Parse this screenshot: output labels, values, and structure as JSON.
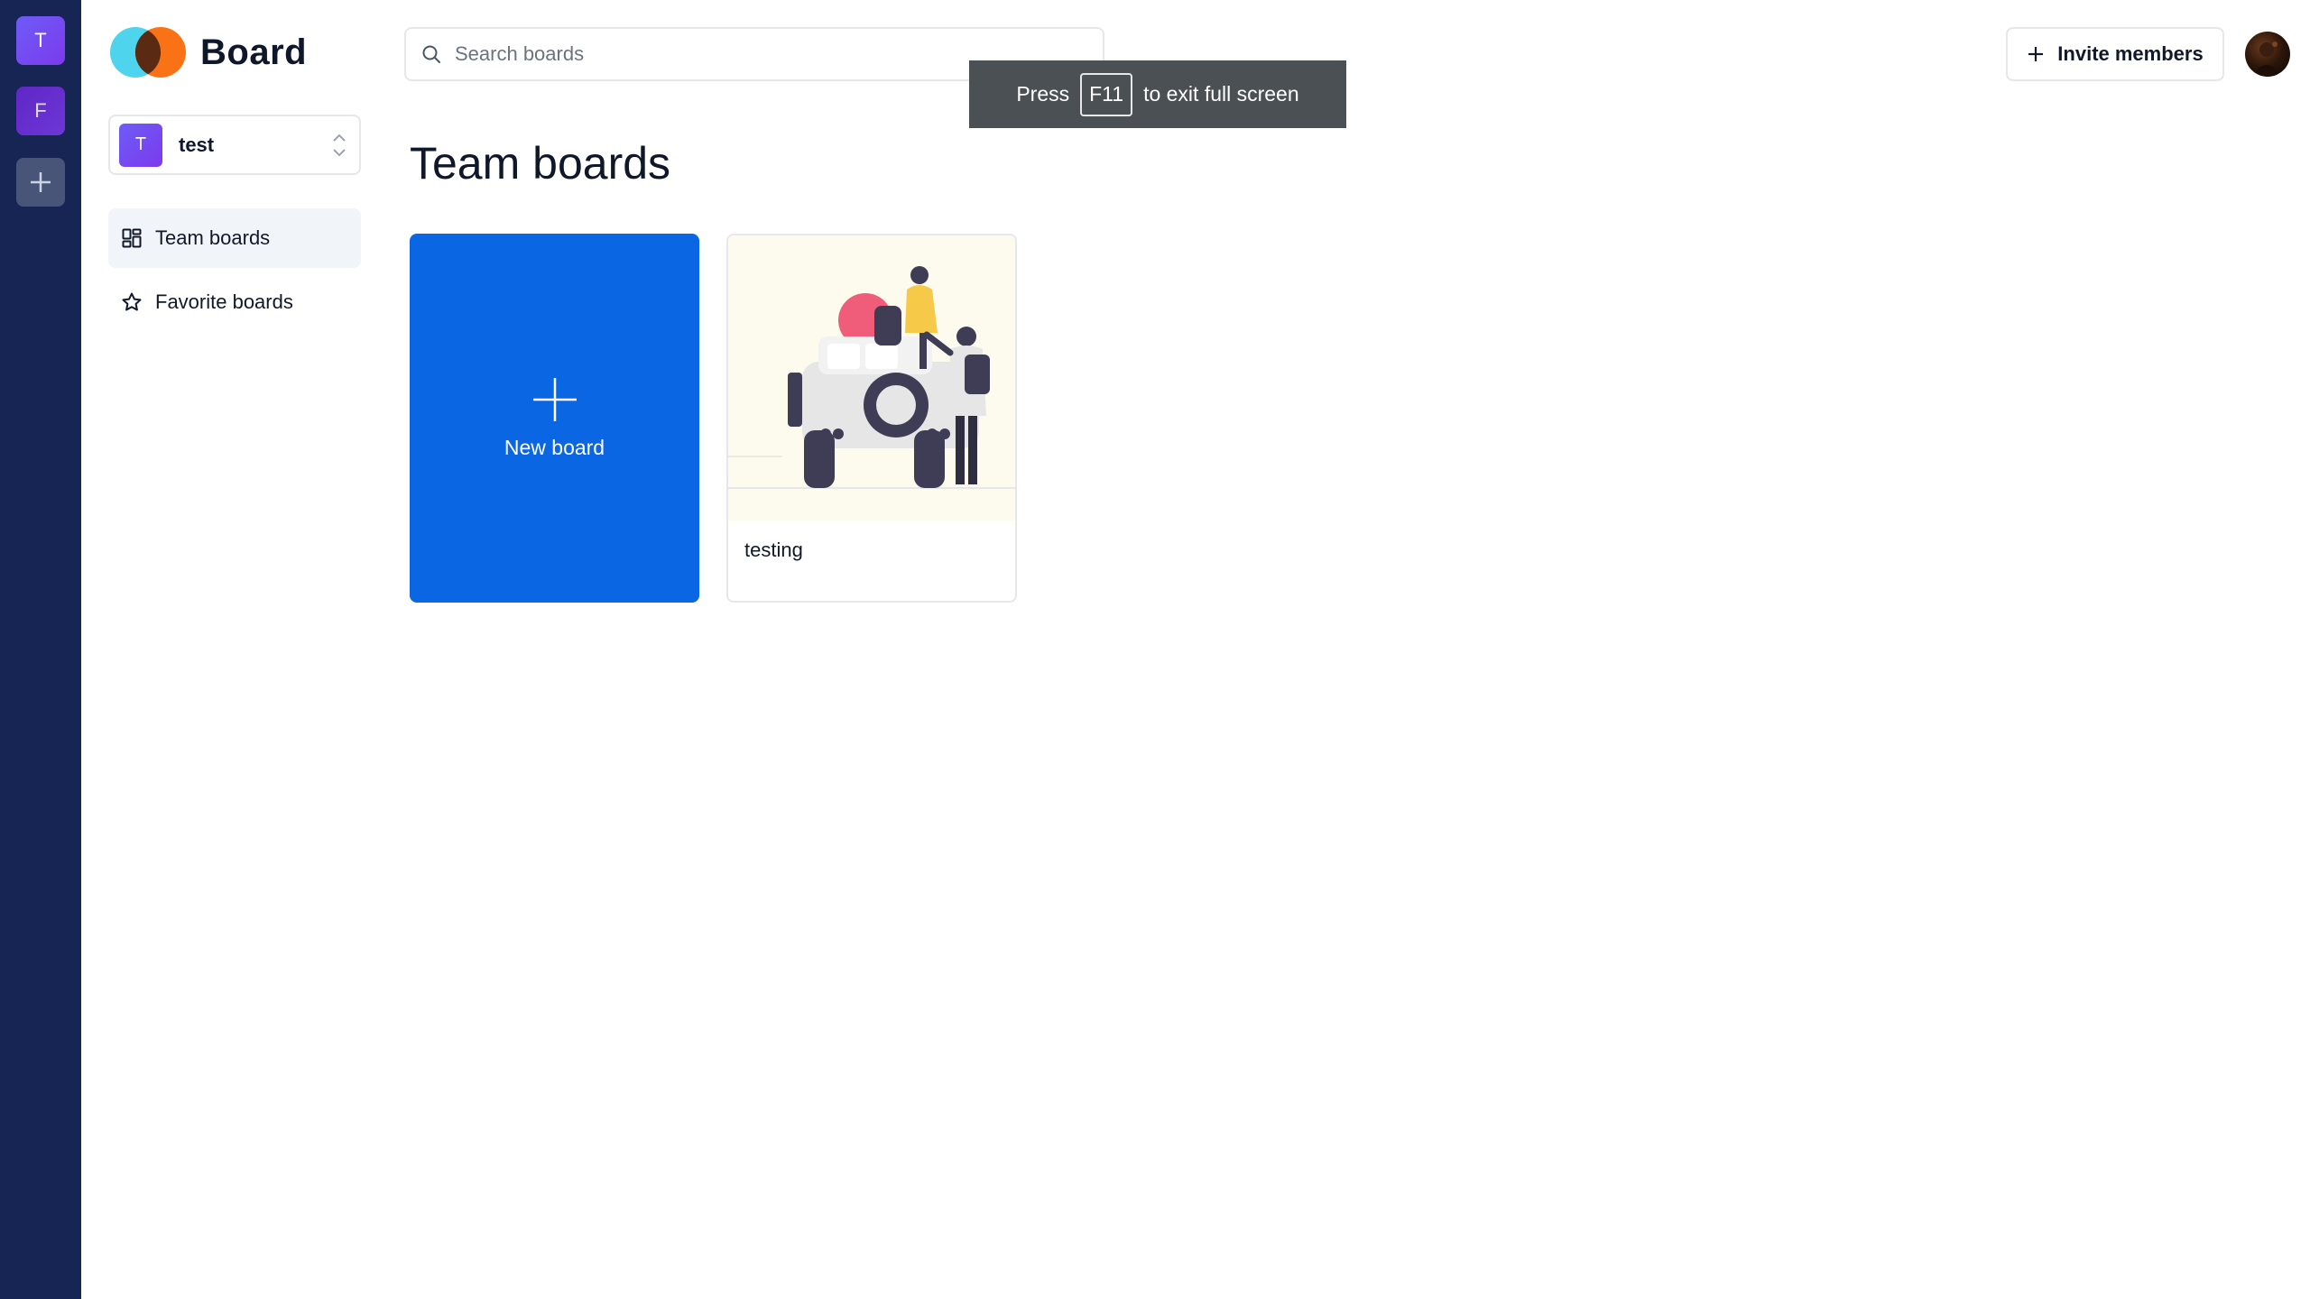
{
  "rail": {
    "orgs": [
      {
        "initial": "T"
      },
      {
        "initial": "F"
      }
    ],
    "add_icon": "plus-icon"
  },
  "sidebar": {
    "logo_title": "Board",
    "org": {
      "initial": "T",
      "name": "test"
    },
    "nav": [
      {
        "label": "Team boards",
        "icon": "dashboard-icon",
        "active": true
      },
      {
        "label": "Favorite boards",
        "icon": "star-icon",
        "active": false
      }
    ]
  },
  "header": {
    "search_placeholder": "Search boards",
    "invite_label": "Invite members"
  },
  "fullscreen_toast": {
    "prefix": "Press",
    "key": "F11",
    "suffix": "to exit full screen"
  },
  "main": {
    "title": "Team boards",
    "new_board_label": "New board",
    "boards": [
      {
        "title": "testing"
      }
    ]
  },
  "colors": {
    "rail_bg": "#172554",
    "primary": "#0b66e4",
    "org_gradient_start": "#6d5cf6",
    "org_gradient_end": "#7c3aed"
  }
}
